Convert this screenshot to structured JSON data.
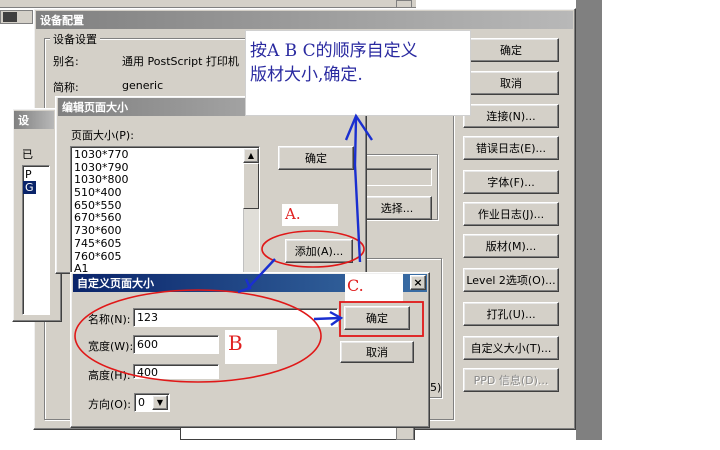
{
  "background_window": {
    "title": "设备配置",
    "group_title": "设备设置",
    "alias_label": "别名:",
    "alias_value": "通用 PostScript 打印机",
    "shortname_label": "简称:",
    "shortname_value": "generic",
    "select_button": "选择...",
    "buttons": [
      "确定",
      "取消",
      "连接(N)...",
      "错误日志(E)...",
      "字体(F)...",
      "作业日志(J)...",
      "版材(M)...",
      "Level 2选项(O)...",
      "打孔(U)...",
      "自定义大小(T)..."
    ],
    "disabled_button": "PPD 信息(D)..."
  },
  "left_window": {
    "title": "设",
    "list_items": [
      "P",
      "G"
    ],
    "frag_label": "已"
  },
  "edit_dialog": {
    "title": "编辑页面大小",
    "page_size_label": "页面大小(P):",
    "sizes": [
      "1030*770",
      "1030*790",
      "1030*800",
      "510*400",
      "650*550",
      "670*560",
      "730*600",
      "745*605",
      "760*605",
      "A1"
    ],
    "ok_button": "确定",
    "add_button": "添加(A)..."
  },
  "custom_dialog": {
    "title": "自定义页面大小",
    "name_label": "名称(N):",
    "name_value": "123",
    "width_label": "宽度(W):",
    "width_value": "600",
    "height_label": "高度(H):",
    "height_value": "400",
    "direction_label": "方向(O):",
    "direction_value": "0",
    "ok_button": "确定",
    "cancel_button": "取消"
  },
  "annotations": {
    "note_line1": "按A B C的顺序自定义",
    "note_line2": "版材大小,确定.",
    "label_a": "A.",
    "label_b": "B",
    "label_c": "C.",
    "arrow_color": "#1a2fd0",
    "ellipse_color": "#e01818"
  },
  "small_fragments": {
    "frag_5": "5)",
    "close_glyph": "×"
  }
}
